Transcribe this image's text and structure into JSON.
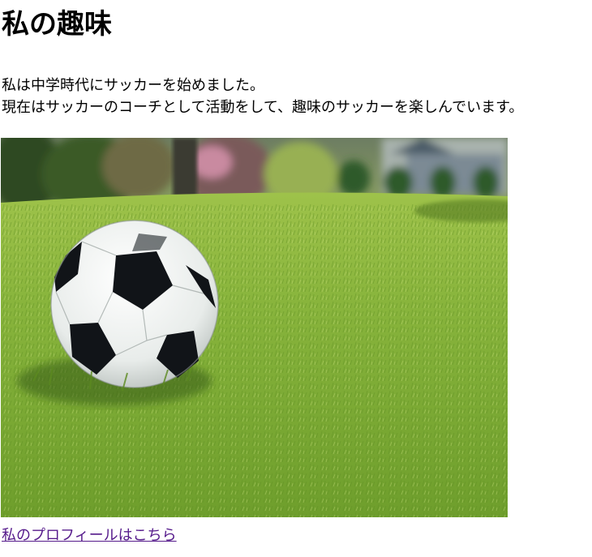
{
  "page": {
    "title": "私の趣味",
    "paragraph_lines": [
      "私は中学時代にサッカーを始めました。",
      "現在はサッカーのコーチとして活動をして、趣味のサッカーを楽しんでいます。"
    ],
    "image": {
      "subject": "soccer ball on grass lawn"
    },
    "link_text": "私のプロフィールはこちら"
  },
  "colors": {
    "link": "#551a8b",
    "grass": "#7fae38",
    "text": "#000000"
  }
}
